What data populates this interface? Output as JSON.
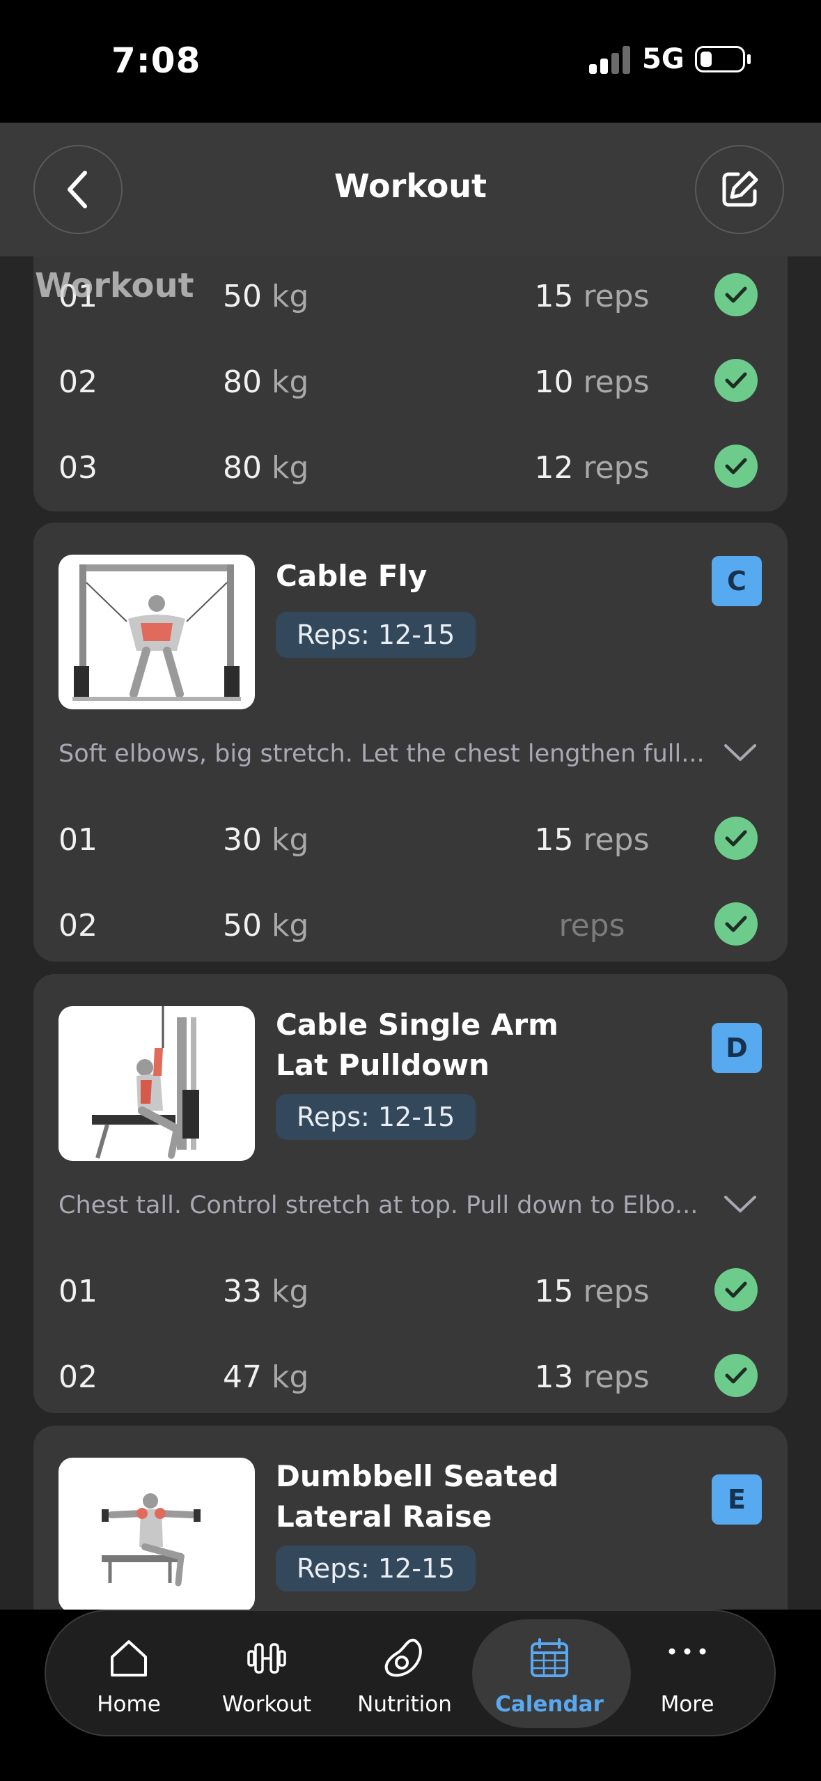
{
  "status_bar": {
    "time": "7:08",
    "network": "5G"
  },
  "header": {
    "title": "Workout",
    "back_icon": "chevron-left-icon",
    "edit_icon": "edit-icon"
  },
  "overlay_title": "Workout",
  "exercises": [
    {
      "id": "prev",
      "sets": [
        {
          "num": "01",
          "weight": "50",
          "weight_unit": "kg",
          "reps": "15",
          "reps_unit": "reps",
          "done": true
        },
        {
          "num": "02",
          "weight": "80",
          "weight_unit": "kg",
          "reps": "10",
          "reps_unit": "reps",
          "done": true
        },
        {
          "num": "03",
          "weight": "80",
          "weight_unit": "kg",
          "reps": "12",
          "reps_unit": "reps",
          "done": true
        }
      ]
    },
    {
      "id": "cable-fly",
      "name_lines": [
        "Cable Fly"
      ],
      "reps_badge": "Reps: 12-15",
      "letter": "C",
      "notes": "Soft elbows, big stretch. Let the chest lengthen full...",
      "sets": [
        {
          "num": "01",
          "weight": "30",
          "weight_unit": "kg",
          "reps": "15",
          "reps_unit": "reps",
          "done": true
        },
        {
          "num": "02",
          "weight": "50",
          "weight_unit": "kg",
          "reps": "",
          "reps_unit": "reps",
          "done": true
        }
      ]
    },
    {
      "id": "lat-pulldown",
      "name_lines": [
        "Cable Single Arm",
        "Lat Pulldown"
      ],
      "reps_badge": "Reps: 12-15",
      "letter": "D",
      "notes": "Chest tall. Control stretch at top. Pull down to Elbo...",
      "sets": [
        {
          "num": "01",
          "weight": "33",
          "weight_unit": "kg",
          "reps": "15",
          "reps_unit": "reps",
          "done": true
        },
        {
          "num": "02",
          "weight": "47",
          "weight_unit": "kg",
          "reps": "13",
          "reps_unit": "reps",
          "done": true
        }
      ]
    },
    {
      "id": "lateral-raise",
      "name_lines": [
        "Dumbbell Seated",
        "Lateral Raise"
      ],
      "reps_badge": "Reps: 12-15",
      "letter": "E"
    }
  ],
  "nav": {
    "items": [
      {
        "label": "Home",
        "icon": "home-icon"
      },
      {
        "label": "Workout",
        "icon": "dumbbell-icon"
      },
      {
        "label": "Nutrition",
        "icon": "avocado-icon"
      },
      {
        "label": "Calendar",
        "icon": "calendar-icon"
      },
      {
        "label": "More",
        "icon": "more-icon"
      }
    ],
    "active": "Calendar"
  },
  "colors": {
    "accent": "#57aaf0",
    "check": "#6dcc8b",
    "card": "#383838",
    "background": "#262626"
  }
}
